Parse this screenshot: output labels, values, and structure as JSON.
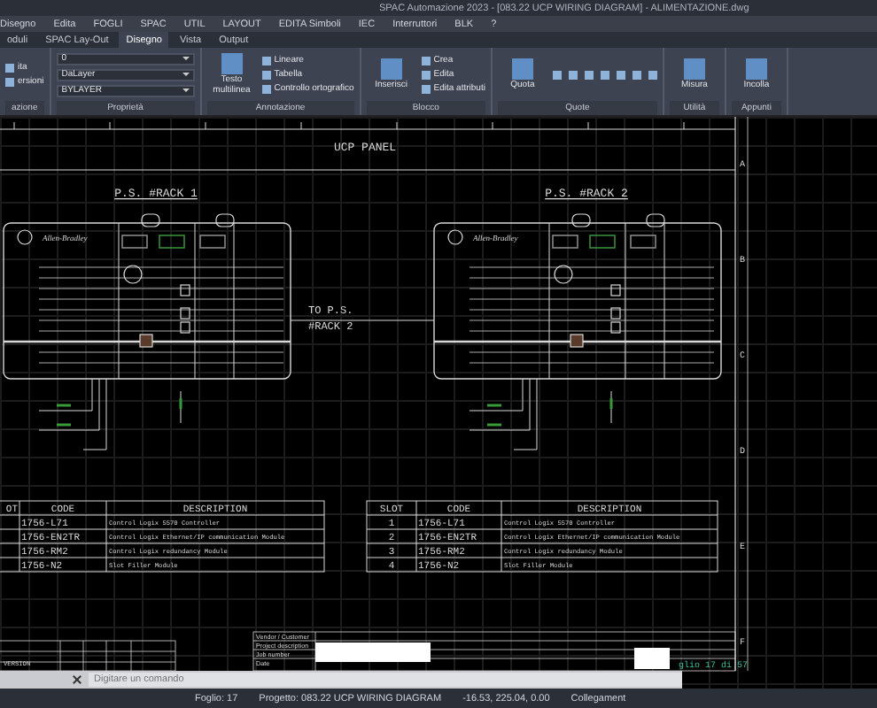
{
  "window": {
    "title": "SPAC Automazione 2023 - [083.22 UCP WIRING DIAGRAM] - ALIMENTAZIONE.dwg"
  },
  "menu": [
    "Disegno",
    "Edita",
    "FOGLI",
    "SPAC",
    "UTIL",
    "LAYOUT",
    "EDITA Simboli",
    "IEC",
    "Interruttori",
    "BLK",
    "?"
  ],
  "tabs": [
    {
      "label": "oduli",
      "selected": false
    },
    {
      "label": "SPAC Lay-Out",
      "selected": false
    },
    {
      "label": "Disegno",
      "selected": true
    },
    {
      "label": "Vista",
      "selected": false
    },
    {
      "label": "Output",
      "selected": false
    }
  ],
  "ribbon": [
    {
      "title": "azione",
      "items": [
        {
          "kind": "small",
          "label": "ita"
        },
        {
          "kind": "small",
          "label": "ersioni"
        }
      ]
    },
    {
      "title": "Proprietà",
      "items": [
        {
          "kind": "combo",
          "label": "0"
        },
        {
          "kind": "combo",
          "label": "DaLayer"
        },
        {
          "kind": "combo",
          "label": "BYLAYER"
        }
      ]
    },
    {
      "title": "Annotazione",
      "items": [
        {
          "kind": "large",
          "label": "Testo multilinea"
        },
        {
          "kind": "small",
          "label": "Lineare"
        },
        {
          "kind": "small",
          "label": "Tabella"
        },
        {
          "kind": "small",
          "label": "Controllo ortografico"
        }
      ]
    },
    {
      "title": "Blocco",
      "items": [
        {
          "kind": "large",
          "label": "Inserisci"
        },
        {
          "kind": "small",
          "label": "Crea"
        },
        {
          "kind": "small",
          "label": "Edita"
        },
        {
          "kind": "small",
          "label": "Edita attributi"
        }
      ]
    },
    {
      "title": "Quote",
      "items": [
        {
          "kind": "large",
          "label": "Quota"
        },
        {
          "kind": "tools"
        }
      ]
    },
    {
      "title": "Utilità",
      "items": [
        {
          "kind": "large",
          "label": "Misura"
        }
      ]
    },
    {
      "title": "Appunti",
      "items": [
        {
          "kind": "large",
          "label": "Incolla"
        }
      ]
    }
  ],
  "drawing": {
    "title": "UCP PANEL",
    "racks": [
      {
        "label": "P.S. #RACK 1",
        "brand": "Allen-Bradley"
      },
      {
        "label": "P.S. #RACK 2",
        "brand": "Allen-Bradley"
      }
    ],
    "link_label": [
      "TO P.S.",
      "#RACK 2"
    ],
    "zones": [
      "A",
      "B",
      "C",
      "D",
      "E",
      "F"
    ],
    "tables": [
      {
        "columns": [
          "OT",
          "CODE",
          "DESCRIPTION"
        ],
        "rows": [
          {
            "code": "1756-L71",
            "description": "Control Logix 5570 Controller"
          },
          {
            "code": "1756-EN2TR",
            "description": "Control Logix Ethernet/IP communication Module"
          },
          {
            "code": "1756-RM2",
            "description": "Control Logix redundancy Module"
          },
          {
            "code": "1756-N2",
            "description": "Slot Filler Module"
          }
        ]
      },
      {
        "columns": [
          "SLOT",
          "CODE",
          "DESCRIPTION"
        ],
        "rows": [
          {
            "slot": "1",
            "code": "1756-L71",
            "description": "Control Logix 5570 Controller"
          },
          {
            "slot": "2",
            "code": "1756-EN2TR",
            "description": "Control Logix Ethernet/IP communication Module"
          },
          {
            "slot": "3",
            "code": "1756-RM2",
            "description": "Control Logix redundancy Module"
          },
          {
            "slot": "4",
            "code": "1756-N2",
            "description": "Slot Filler Module"
          }
        ]
      }
    ],
    "revision_label": "VERSION",
    "title_block": [
      "Vendor / Customer",
      "Project description",
      "Job number",
      "Date"
    ],
    "sheet": "glio 17 di 57"
  },
  "command_line": {
    "placeholder": "Digitare un comando"
  },
  "status_bar": [
    "Foglio: 17",
    "Progetto: 083.22 UCP WIRING DIAGRAM",
    "-16.53, 225.04, 0.00",
    "Collegament"
  ]
}
